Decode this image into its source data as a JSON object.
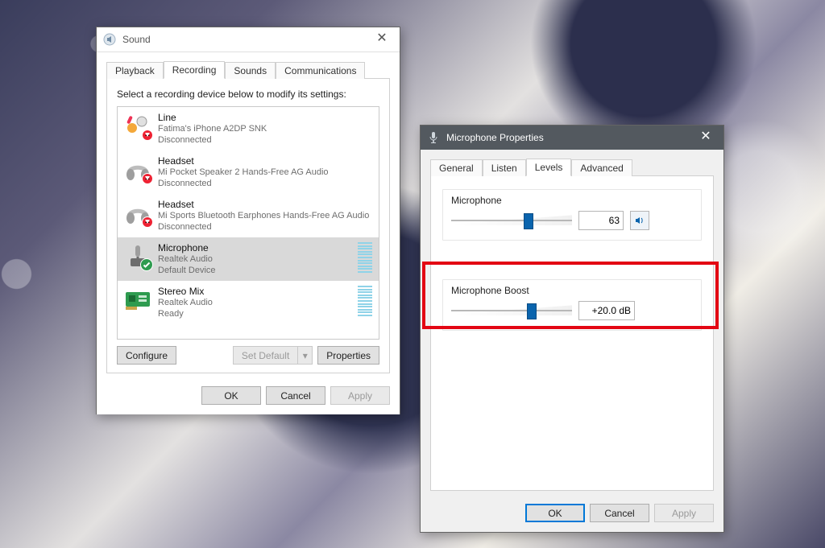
{
  "sound": {
    "title": "Sound",
    "tabs": [
      "Playback",
      "Recording",
      "Sounds",
      "Communications"
    ],
    "active_tab": 1,
    "instruction": "Select a recording device below to modify its settings:",
    "devices": [
      {
        "name": "Line",
        "line2": "Fatima's iPhone A2DP SNK",
        "status": "Disconnected",
        "icon": "line",
        "badge": "disc",
        "meter": false,
        "selected": false
      },
      {
        "name": "Headset",
        "line2": "Mi Pocket Speaker 2 Hands-Free AG Audio",
        "status": "Disconnected",
        "icon": "headset",
        "badge": "disc",
        "meter": false,
        "selected": false
      },
      {
        "name": "Headset",
        "line2": "Mi Sports Bluetooth Earphones Hands-Free AG Audio",
        "status": "Disconnected",
        "icon": "headset",
        "badge": "disc",
        "meter": false,
        "selected": false
      },
      {
        "name": "Microphone",
        "line2": "Realtek Audio",
        "status": "Default Device",
        "icon": "mic",
        "badge": "ok",
        "meter": true,
        "selected": true
      },
      {
        "name": "Stereo Mix",
        "line2": "Realtek Audio",
        "status": "Ready",
        "icon": "card",
        "badge": "none",
        "meter": true,
        "selected": false
      }
    ],
    "buttons": {
      "configure": "Configure",
      "set_default": "Set Default",
      "properties": "Properties",
      "ok": "OK",
      "cancel": "Cancel",
      "apply": "Apply"
    }
  },
  "mic": {
    "title": "Microphone Properties",
    "tabs": [
      "General",
      "Listen",
      "Levels",
      "Advanced"
    ],
    "active_tab": 2,
    "levels": {
      "mic_label": "Microphone",
      "mic_value": "63",
      "mic_pos": 0.63,
      "boost_label": "Microphone Boost",
      "boost_value": "+20.0 dB",
      "boost_pos": 0.66
    },
    "buttons": {
      "ok": "OK",
      "cancel": "Cancel",
      "apply": "Apply"
    }
  }
}
